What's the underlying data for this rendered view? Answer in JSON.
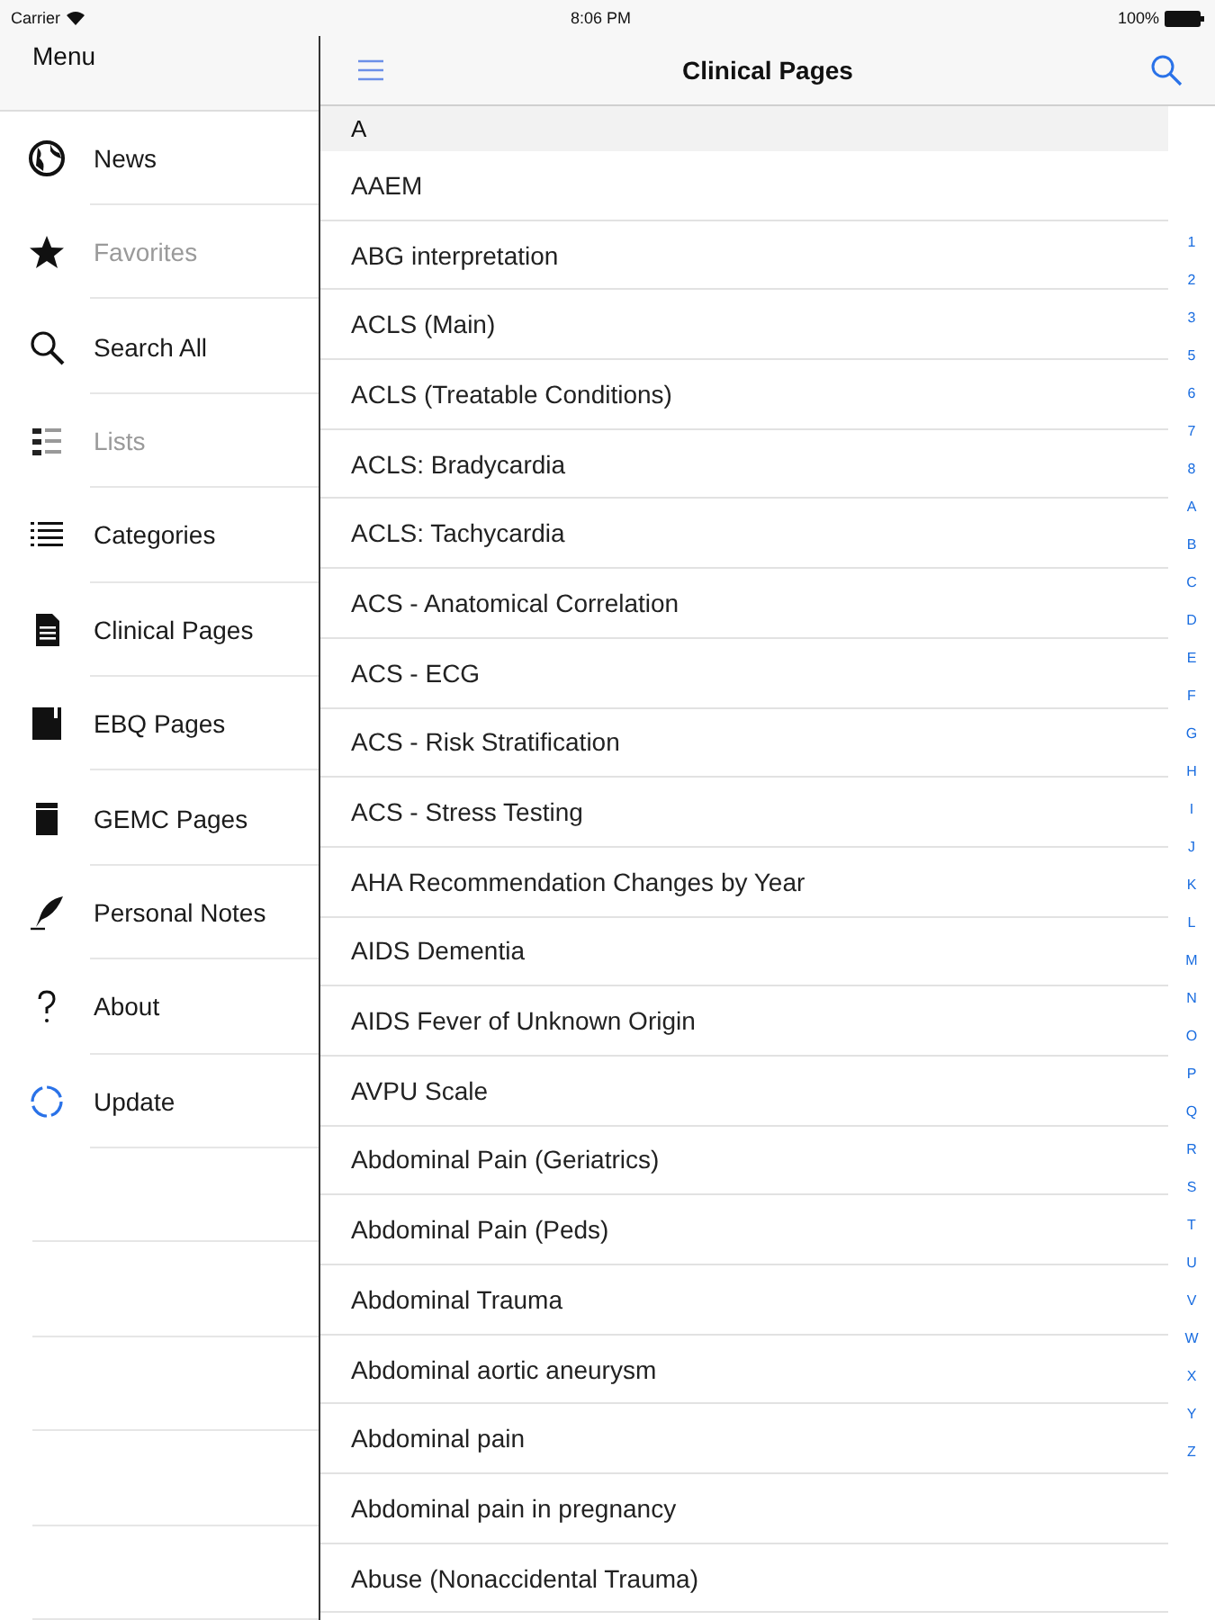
{
  "status_bar": {
    "carrier": "Carrier",
    "time": "8:06 PM",
    "battery": "100%"
  },
  "sidebar": {
    "title": "Menu",
    "items": [
      {
        "label": "News",
        "disabled": false
      },
      {
        "label": "Favorites",
        "disabled": true
      },
      {
        "label": "Search All",
        "disabled": false
      },
      {
        "label": "Lists",
        "disabled": true
      },
      {
        "label": "Categories",
        "disabled": false
      },
      {
        "label": "Clinical Pages",
        "disabled": false
      },
      {
        "label": "EBQ Pages",
        "disabled": false
      },
      {
        "label": "GEMC Pages",
        "disabled": false
      },
      {
        "label": "Personal Notes",
        "disabled": false
      },
      {
        "label": "About",
        "disabled": false
      },
      {
        "label": "Update",
        "disabled": false
      }
    ]
  },
  "nav_bar": {
    "title": "Clinical Pages"
  },
  "section": {
    "header": "A",
    "rows": [
      "AAEM",
      "ABG interpretation",
      "ACLS (Main)",
      "ACLS (Treatable Conditions)",
      "ACLS: Bradycardia",
      "ACLS: Tachycardia",
      "ACS - Anatomical Correlation",
      "ACS - ECG",
      "ACS - Risk Stratification",
      "ACS - Stress Testing",
      "AHA Recommendation Changes by Year",
      "AIDS Dementia",
      "AIDS Fever of Unknown Origin",
      "AVPU Scale",
      "Abdominal Pain (Geriatrics)",
      "Abdominal Pain (Peds)",
      "Abdominal Trauma",
      "Abdominal aortic aneurysm",
      "Abdominal pain",
      "Abdominal pain in pregnancy",
      "Abuse (Nonaccidental Trauma)"
    ]
  },
  "index": [
    "1",
    "2",
    "3",
    "5",
    "6",
    "7",
    "8",
    "A",
    "B",
    "C",
    "D",
    "E",
    "F",
    "G",
    "H",
    "I",
    "J",
    "K",
    "L",
    "M",
    "N",
    "O",
    "P",
    "Q",
    "R",
    "S",
    "T",
    "U",
    "V",
    "W",
    "X",
    "Y",
    "Z"
  ]
}
